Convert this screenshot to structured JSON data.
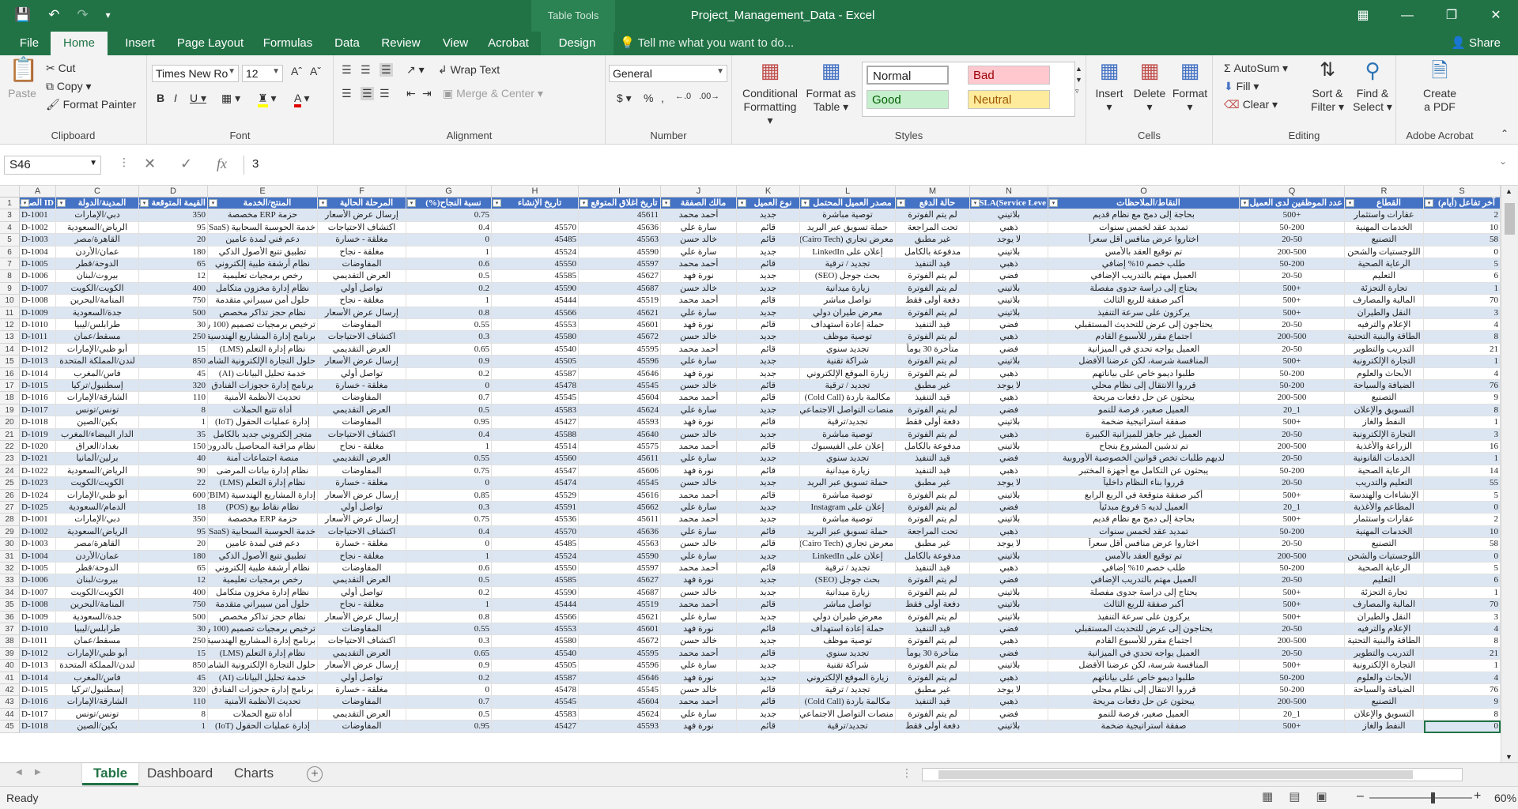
{
  "app": {
    "document_title": "Project_Management_Data - Excel",
    "table_tools": "Table Tools",
    "quick_access": [
      "save-icon",
      "undo-icon",
      "redo-icon",
      "customize-icon"
    ],
    "window_buttons": [
      "ribbon-display-icon",
      "minimize-icon",
      "restore-icon",
      "close-icon"
    ]
  },
  "tabs": [
    {
      "label": "File"
    },
    {
      "label": "Home"
    },
    {
      "label": "Insert"
    },
    {
      "label": "Page Layout"
    },
    {
      "label": "Formulas"
    },
    {
      "label": "Data"
    },
    {
      "label": "Review"
    },
    {
      "label": "View"
    },
    {
      "label": "Acrobat"
    },
    {
      "label": "Design"
    }
  ],
  "tell_me": "Tell me what you want to do...",
  "share": "Share",
  "ribbon": {
    "clipboard": {
      "paste": "Paste",
      "cut": "Cut",
      "copy": "Copy",
      "format_painter": "Format Painter",
      "label": "Clipboard"
    },
    "font": {
      "name": "Times New Ro",
      "size": "12",
      "label": "Font"
    },
    "alignment": {
      "wrap_text": "Wrap Text",
      "merge_center": "Merge & Center",
      "label": "Alignment"
    },
    "number": {
      "format": "General",
      "label": "Number"
    },
    "styles": {
      "conditional": "Conditional",
      "conditional2": "Formatting",
      "format_as": "Format as",
      "format_as2": "Table",
      "normal": "Normal",
      "bad": "Bad",
      "good": "Good",
      "neutral": "Neutral",
      "label": "Styles"
    },
    "cells": {
      "insert": "Insert",
      "delete": "Delete",
      "format": "Format",
      "label": "Cells"
    },
    "editing": {
      "autosum": "AutoSum",
      "fill": "Fill",
      "clear": "Clear",
      "sort": "Sort &",
      "sort2": "Filter",
      "find": "Find &",
      "find2": "Select",
      "label": "Editing"
    },
    "acrobat": {
      "create": "Create",
      "create2": "a PDF",
      "label": "Adobe Acrobat"
    }
  },
  "formula_bar": {
    "name_box": "S46",
    "value": "3"
  },
  "colors": {
    "excel_green": "#217346",
    "header_blue": "#4472c4",
    "band": "#dce6f2"
  },
  "columns": [
    "A",
    "C",
    "D",
    "E",
    "F",
    "G",
    "H",
    "I",
    "J",
    "K",
    "L",
    "M",
    "N",
    "O",
    "Q",
    "R",
    "S"
  ],
  "header_row": [
    "ID الصفقة",
    "المدينة/الدولة",
    "القيمة المتوقعة (USD)",
    "المنتج/الخدمة",
    "المرحلة الحالية",
    "نسبة النجاح(%)",
    "تاريخ الإنشاء",
    "تاريخ اغلاق المتوقع",
    "مالك الصفقة",
    "نوع العميل",
    "مصدر العميل المحتمل",
    "حالة الدفع",
    "SLA(Service Leve",
    "النقاط/الملاحظات",
    "عدد الموظفين لدى العميل",
    "القطاع",
    "آخر تفاعل (أيام)"
  ],
  "rows": [
    [
      "3",
      "D-1001",
      "دبي/الإمارات",
      "350",
      "حزمة ERP مخصصة",
      "إرسال عرض الأسعار",
      "0.75",
      "",
      "45611",
      "أحمد محمد",
      "جديد",
      "توصية مباشرة",
      "لم يتم الفوترة",
      "بلاتيني",
      "بحاجة إلى دمج مع نظام قديم",
      "+500",
      "عقارات واستثمار",
      "2"
    ],
    [
      "4",
      "D-1002",
      "الرياض/السعودية",
      "95",
      "خدمة الحوسبة السحابية (SaaS)",
      "اكتشاف الاحتياجات",
      "0.4",
      "45570",
      "45636",
      "سارة علي",
      "قائم",
      "حملة تسويق عبر البريد",
      "تحت المراجعة",
      "ذهبي",
      "تمديد عقد لخمس سنوات",
      "50-200",
      "الخدمات المهنية",
      "10"
    ],
    [
      "5",
      "D-1003",
      "القاهرة/مصر",
      "20",
      "دعم فني لمدة عامين",
      "مغلقة - خسارة",
      "0",
      "45485",
      "45563",
      "خالد حسن",
      "قائم",
      "معرض تجاري (Cairo Tech)",
      "غير مطبق",
      "لا يوجد",
      "اختاروا عرض منافس أقل سعراً",
      "20-50",
      "التصنيع",
      "58"
    ],
    [
      "6",
      "D-1004",
      "عمان/الأردن",
      "180",
      "تطبيق تتبع الأصول الذكي",
      "مغلقة - نجاح",
      "1",
      "45524",
      "45590",
      "سارة علي",
      "جديد",
      "إعلان على LinkedIn",
      "مدفوعة بالكامل",
      "بلاتيني",
      "تم توقيع العقد بالأمس",
      "200-500",
      "اللوجستيات والشحن",
      "0"
    ],
    [
      "7",
      "D-1005",
      "الدوحة/قطر",
      "65",
      "نظام أرشفة طبية إلكتروني",
      "المفاوضات",
      "0.6",
      "45550",
      "45597",
      "أحمد محمد",
      "قائم",
      "تجديد / ترقية",
      "قيد التنفيذ",
      "ذهبي",
      "طلب خصم 10% إضافي",
      "50-200",
      "الرعاية الصحية",
      "5"
    ],
    [
      "8",
      "D-1006",
      "بيروت/لبنان",
      "12",
      "رخص برمجيات تعليمية",
      "العرض التقديمي",
      "0.5",
      "45585",
      "45627",
      "نورة فهد",
      "جديد",
      "بحث جوجل (SEO)",
      "لم يتم الفوترة",
      "فضي",
      "العميل مهتم بالتدريب الإضافي",
      "20-50",
      "التعليم",
      "6"
    ],
    [
      "9",
      "D-1007",
      "الكويت/الكويت",
      "400",
      "نظام إدارة مخزون متكامل",
      "تواصل أولي",
      "0.2",
      "45590",
      "45687",
      "خالد حسن",
      "جديد",
      "زيارة ميدانية",
      "لم يتم الفوترة",
      "بلاتيني",
      "يحتاج إلى دراسة جدوى مفصلة",
      "+500",
      "تجارة التجزئة",
      "1"
    ],
    [
      "10",
      "D-1008",
      "المنامة/البحرين",
      "750",
      "حلول أمن سيبراني متقدمة",
      "مغلقة - نجاح",
      "1",
      "45444",
      "45519",
      "أحمد محمد",
      "قائم",
      "تواصل مباشر",
      "دفعة أولى فقط",
      "بلاتيني",
      "أكبر صفقة للربع الثالث",
      "+500",
      "المالية والمصارف",
      "70"
    ],
    [
      "11",
      "D-1009",
      "جدة/السعودية",
      "500",
      "نظام حجز تذاكر مخصص",
      "إرسال عرض الأسعار",
      "0.8",
      "45566",
      "45621",
      "سارة علي",
      "جديد",
      "معرض طيران دولي",
      "لم يتم الفوترة",
      "بلاتيني",
      "يركزون على سرعة التنفيذ",
      "+500",
      "النقل والطيران",
      "3"
    ],
    [
      "12",
      "D-1010",
      "طرابلس/ليبيا",
      "30",
      "ترخيص برمجيات تصميم (100 رخصة)",
      "المفاوضات",
      "0.55",
      "45553",
      "45601",
      "نورة فهد",
      "قائم",
      "حملة إعادة استهداف",
      "قيد التنفيذ",
      "فضي",
      "يحتاجون إلى عرض للتحديث المستقبلي",
      "20-50",
      "الإعلام والترفيه",
      "4"
    ],
    [
      "13",
      "D-1011",
      "مسقط/عمان",
      "250",
      "برنامج إدارة المشاريع الهندسية",
      "اكتشاف الاحتياجات",
      "0.3",
      "45580",
      "45672",
      "خالد حسن",
      "جديد",
      "توصية موظف",
      "لم يتم الفوترة",
      "ذهبي",
      "اجتماع مقرر للأسبوع القادم",
      "200-500",
      "الطاقة والبنية التحتية",
      "8"
    ],
    [
      "14",
      "D-1012",
      "أبو ظبي/الإمارات",
      "15",
      "نظام إدارة التعلم (LMS)",
      "العرض التقديمي",
      "0.65",
      "45540",
      "45595",
      "أحمد محمد",
      "قائم",
      "تجديد سنوي",
      "متأخرة 30 يوماً",
      "فضي",
      "العميل يواجه تحدي في الميزانية",
      "20-50",
      "التدريب والتطوير",
      "21"
    ],
    [
      "15",
      "D-1013",
      "لندن/المملكة المتحدة",
      "850",
      "حلول التجارة الإلكترونية الشاملة",
      "إرسال عرض الأسعار",
      "0.9",
      "45505",
      "45596",
      "سارة علي",
      "جديد",
      "شراكة تقنية",
      "لم يتم الفوترة",
      "بلاتيني",
      "المنافسة شرسة، لكن عرضنا الأفضل",
      "+500",
      "التجارة الإلكترونية",
      "1"
    ],
    [
      "16",
      "D-1014",
      "فاس/المغرب",
      "45",
      "خدمة تحليل البيانات (AI)",
      "تواصل أولي",
      "0.2",
      "45587",
      "45646",
      "نورة فهد",
      "جديد",
      "زيارة الموقع الإلكتروني",
      "لم يتم الفوترة",
      "ذهبي",
      "طلبوا ديمو خاص على بياناتهم",
      "50-200",
      "الأبحاث والعلوم",
      "4"
    ],
    [
      "17",
      "D-1015",
      "إسطنبول/تركيا",
      "320",
      "برنامج إدارة حجوزات الفنادق",
      "مغلقة - خسارة",
      "0",
      "45478",
      "45545",
      "خالد حسن",
      "قائم",
      "تجديد / ترقية",
      "غير مطبق",
      "لا يوجد",
      "قرروا الانتقال إلى نظام محلي",
      "50-200",
      "الضيافة والسياحة",
      "76"
    ],
    [
      "18",
      "D-1016",
      "الشارقة/الإمارات",
      "110",
      "تحديث الأنظمة الأمنية",
      "المفاوضات",
      "0.7",
      "45545",
      "45604",
      "أحمد محمد",
      "قائم",
      "مكالمة باردة (Cold Call)",
      "قيد التنفيذ",
      "ذهبي",
      "يبحثون عن حل دفعات مريحة",
      "200-500",
      "التصنيع",
      "9"
    ],
    [
      "19",
      "D-1017",
      "تونس/تونس",
      "8",
      "أداة تتبع الحملات",
      "العرض التقديمي",
      "0.5",
      "45583",
      "45624",
      "سارة علي",
      "جديد",
      "منصات التواصل الاجتماعي",
      "لم يتم الفوترة",
      "فضي",
      "العميل صغير، فرصة للنمو",
      "1_20",
      "التسويق والإعلان",
      "8"
    ],
    [
      "20",
      "D-1018",
      "بكين/الصين",
      "1",
      "إدارة عمليات الحقول (IoT)",
      "المفاوضات",
      "0.95",
      "45427",
      "45593",
      "نورة فهد",
      "قائم",
      "تجديد/ترقية",
      "دفعة أولى فقط",
      "بلاتيني",
      "صفقة استراتيجية ضخمة",
      "+500",
      "النفط والغاز",
      "1"
    ],
    [
      "21",
      "D-1019",
      "الدار البيضاء/المغرب",
      "35",
      "متجر إلكتروني جديد بالكامل",
      "اكتشاف الاحتياجات",
      "0.4",
      "45588",
      "45640",
      "خالد حسن",
      "جديد",
      "توصية مباشرة",
      "لم يتم الفوترة",
      "ذهبي",
      "العميل غير جاهز للميزانية الكبيرة",
      "20-50",
      "التجارة الإلكترونية",
      "3"
    ],
    [
      "22",
      "D-1020",
      "بغداد/العراق",
      "150",
      "نظام مراقبة المحاصيل بالدرون",
      "مغلقة - نجاح",
      "1",
      "45514",
      "45575",
      "أحمد محمد",
      "قائم",
      "إعلان على الفيسبوك",
      "مدفوعة بالكامل",
      "بلاتيني",
      "تم تدشين المشروع بنجاح",
      "200-500",
      "الزراعة والأغذية",
      "16"
    ],
    [
      "23",
      "D-1021",
      "برلين/ألمانيا",
      "40",
      "منصة اجتماعات آمنة",
      "العرض التقديمي",
      "0.55",
      "45560",
      "45611",
      "سارة علي",
      "جديد",
      "تجديد سنوي",
      "قيد التنفيذ",
      "فضي",
      "لديهم طلبات تخص قوانين الخصوصية الأوروبية",
      "20-50",
      "الخدمات القانونية",
      "1"
    ],
    [
      "24",
      "D-1022",
      "الرياض/السعودية",
      "90",
      "نظام إدارة بيانات المرضى",
      "المفاوضات",
      "0.75",
      "45547",
      "45606",
      "نورة فهد",
      "قائم",
      "زيارة ميدانية",
      "قيد التنفيذ",
      "ذهبي",
      "يبحثون عن التكامل مع أجهزة المختبر",
      "50-200",
      "الرعاية الصحية",
      "14"
    ],
    [
      "25",
      "D-1023",
      "الكويت/الكويت",
      "22",
      "نظام إدارة التعلم (LMS)",
      "مغلقة - خسارة",
      "0",
      "45474",
      "45545",
      "خالد حسن",
      "جديد",
      "حملة تسويق عبر البريد",
      "غير مطبق",
      "لا يوجد",
      "قرروا بناء النظام داخلياً",
      "20-50",
      "التعليم والتدريب",
      "55"
    ],
    [
      "26",
      "D-1024",
      "أبو ظبي/الإمارات",
      "600",
      "إدارة المشاريع الهندسية (BIM)",
      "إرسال عرض الأسعار",
      "0.85",
      "45529",
      "45616",
      "أحمد محمد",
      "قائم",
      "توصية مباشرة",
      "لم يتم الفوترة",
      "بلاتيني",
      "أكبر صفقة متوقعة في الربع الرابع",
      "+500",
      "الإنشاءات والهندسة",
      "5"
    ],
    [
      "27",
      "D-1025",
      "الدمام/السعودية",
      "18",
      "نظام نقاط بيع (POS)",
      "تواصل أولي",
      "0.3",
      "45591",
      "45662",
      "سارة علي",
      "جديد",
      "إعلان على Instagram",
      "لم يتم الفوترة",
      "فضي",
      "العميل لديه 5 فروع مبدئياً",
      "1_20",
      "المطاعم والأغذية",
      "0"
    ],
    [
      "28",
      "D-1001",
      "دبي/الإمارات",
      "350",
      "حزمة ERP مخصصة",
      "إرسال عرض الأسعار",
      "0.75",
      "45536",
      "45611",
      "أحمد محمد",
      "جديد",
      "توصية مباشرة",
      "لم يتم الفوترة",
      "بلاتيني",
      "بحاجة إلى دمج مع نظام قديم",
      "+500",
      "عقارات واستثمار",
      "2"
    ],
    [
      "29",
      "D-1002",
      "الرياض/السعودية",
      "95",
      "خدمة الحوسبة السحابية (SaaS)",
      "اكتشاف الاحتياجات",
      "0.4",
      "45570",
      "45636",
      "سارة علي",
      "قائم",
      "حملة تسويق عبر البريد",
      "تحت المراجعة",
      "ذهبي",
      "تمديد عقد لخمس سنوات",
      "50-200",
      "الخدمات المهنية",
      "10"
    ],
    [
      "30",
      "D-1003",
      "القاهرة/مصر",
      "20",
      "دعم فني لمدة عامين",
      "مغلقة - خسارة",
      "0",
      "45485",
      "45563",
      "خالد حسن",
      "قائم",
      "معرض تجاري (Cairo Tech)",
      "غير مطبق",
      "لا يوجد",
      "اختاروا عرض منافس أقل سعراً",
      "20-50",
      "التصنيع",
      "58"
    ],
    [
      "31",
      "D-1004",
      "عمان/الأردن",
      "180",
      "تطبيق تتبع الأصول الذكي",
      "مغلقة - نجاح",
      "1",
      "45524",
      "45590",
      "سارة علي",
      "جديد",
      "إعلان على LinkedIn",
      "مدفوعة بالكامل",
      "بلاتيني",
      "تم توقيع العقد بالأمس",
      "200-500",
      "اللوجستيات والشحن",
      "0"
    ],
    [
      "32",
      "D-1005",
      "الدوحة/قطر",
      "65",
      "نظام أرشفة طبية إلكتروني",
      "المفاوضات",
      "0.6",
      "45550",
      "45597",
      "أحمد محمد",
      "قائم",
      "تجديد / ترقية",
      "قيد التنفيذ",
      "ذهبي",
      "طلب خصم 10% إضافي",
      "50-200",
      "الرعاية الصحية",
      "5"
    ],
    [
      "33",
      "D-1006",
      "بيروت/لبنان",
      "12",
      "رخص برمجيات تعليمية",
      "العرض التقديمي",
      "0.5",
      "45585",
      "45627",
      "نورة فهد",
      "جديد",
      "بحث جوجل (SEO)",
      "لم يتم الفوترة",
      "فضي",
      "العميل مهتم بالتدريب الإضافي",
      "20-50",
      "التعليم",
      "6"
    ],
    [
      "34",
      "D-1007",
      "الكويت/الكويت",
      "400",
      "نظام إدارة مخزون متكامل",
      "تواصل أولي",
      "0.2",
      "45590",
      "45687",
      "خالد حسن",
      "جديد",
      "زيارة ميدانية",
      "لم يتم الفوترة",
      "بلاتيني",
      "يحتاج إلى دراسة جدوى مفصلة",
      "+500",
      "تجارة التجزئة",
      "1"
    ],
    [
      "35",
      "D-1008",
      "المنامة/البحرين",
      "750",
      "حلول أمن سيبراني متقدمة",
      "مغلقة - نجاح",
      "1",
      "45444",
      "45519",
      "أحمد محمد",
      "قائم",
      "تواصل مباشر",
      "دفعة أولى فقط",
      "بلاتيني",
      "أكبر صفقة للربع الثالث",
      "+500",
      "المالية والمصارف",
      "70"
    ],
    [
      "36",
      "D-1009",
      "جدة/السعودية",
      "500",
      "نظام حجز تذاكر مخصص",
      "إرسال عرض الأسعار",
      "0.8",
      "45566",
      "45621",
      "سارة علي",
      "جديد",
      "معرض طيران دولي",
      "لم يتم الفوترة",
      "بلاتيني",
      "يركزون على سرعة التنفيذ",
      "+500",
      "النقل والطيران",
      "3"
    ],
    [
      "37",
      "D-1010",
      "طرابلس/ليبيا",
      "30",
      "ترخيص برمجيات تصميم (100 رخصة)",
      "المفاوضات",
      "0.55",
      "45553",
      "45601",
      "نورة فهد",
      "قائم",
      "حملة إعادة استهداف",
      "قيد التنفيذ",
      "فضي",
      "يحتاجون إلى عرض للتحديث المستقبلي",
      "20-50",
      "الإعلام والترفيه",
      "4"
    ],
    [
      "38",
      "D-1011",
      "مسقط/عمان",
      "250",
      "برنامج إدارة المشاريع الهندسية",
      "اكتشاف الاحتياجات",
      "0.3",
      "45580",
      "45672",
      "خالد حسن",
      "جديد",
      "توصية موظف",
      "لم يتم الفوترة",
      "ذهبي",
      "اجتماع مقرر للأسبوع القادم",
      "200-500",
      "الطاقة والبنية التحتية",
      "8"
    ],
    [
      "39",
      "D-1012",
      "أبو ظبي/الإمارات",
      "15",
      "نظام إدارة التعلم (LMS)",
      "العرض التقديمي",
      "0.65",
      "45540",
      "45595",
      "أحمد محمد",
      "قائم",
      "تجديد سنوي",
      "متأخرة 30 يوماً",
      "فضي",
      "العميل يواجه تحدي في الميزانية",
      "20-50",
      "التدريب والتطوير",
      "21"
    ],
    [
      "40",
      "D-1013",
      "لندن/المملكة المتحدة",
      "850",
      "حلول التجارة الإلكترونية الشاملة",
      "إرسال عرض الأسعار",
      "0.9",
      "45505",
      "45596",
      "سارة علي",
      "جديد",
      "شراكة تقنية",
      "لم يتم الفوترة",
      "بلاتيني",
      "المنافسة شرسة، لكن عرضنا الأفضل",
      "+500",
      "التجارة الإلكترونية",
      "1"
    ],
    [
      "41",
      "D-1014",
      "فاس/المغرب",
      "45",
      "خدمة تحليل البيانات (AI)",
      "تواصل أولي",
      "0.2",
      "45587",
      "45646",
      "نورة فهد",
      "جديد",
      "زيارة الموقع الإلكتروني",
      "لم يتم الفوترة",
      "ذهبي",
      "طلبوا ديمو خاص على بياناتهم",
      "50-200",
      "الأبحاث والعلوم",
      "4"
    ],
    [
      "42",
      "D-1015",
      "إسطنبول/تركيا",
      "320",
      "برنامج إدارة حجوزات الفنادق",
      "مغلقة - خسارة",
      "0",
      "45478",
      "45545",
      "خالد حسن",
      "قائم",
      "تجديد / ترقية",
      "غير مطبق",
      "لا يوجد",
      "قرروا الانتقال إلى نظام محلي",
      "50-200",
      "الضيافة والسياحة",
      "76"
    ],
    [
      "43",
      "D-1016",
      "الشارقة/الإمارات",
      "110",
      "تحديث الأنظمة الأمنية",
      "المفاوضات",
      "0.7",
      "45545",
      "45604",
      "أحمد محمد",
      "قائم",
      "مكالمة باردة (Cold Call)",
      "قيد التنفيذ",
      "ذهبي",
      "يبحثون عن حل دفعات مريحة",
      "200-500",
      "التصنيع",
      "9"
    ],
    [
      "44",
      "D-1017",
      "تونس/تونس",
      "8",
      "أداة تتبع الحملات",
      "العرض التقديمي",
      "0.5",
      "45583",
      "45624",
      "سارة علي",
      "جديد",
      "منصات التواصل الاجتماعي",
      "لم يتم الفوترة",
      "فضي",
      "العميل صغير، فرصة للنمو",
      "1_20",
      "التسويق والإعلان",
      "8"
    ],
    [
      "45",
      "D-1018",
      "بكين/الصين",
      "1",
      "إدارة عمليات الحقول (IoT)",
      "المفاوضات",
      "0.95",
      "45427",
      "45593",
      "نورة فهد",
      "قائم",
      "تجديد/ترقية",
      "دفعة أولى فقط",
      "بلاتيني",
      "صفقة استراتيجية ضخمة",
      "+500",
      "النفط والغاز",
      "0"
    ]
  ],
  "sheets": [
    {
      "label": "Table",
      "active": true
    },
    {
      "label": "Dashboard"
    },
    {
      "label": "Charts"
    }
  ],
  "status": {
    "ready": "Ready",
    "zoom": "60%"
  }
}
